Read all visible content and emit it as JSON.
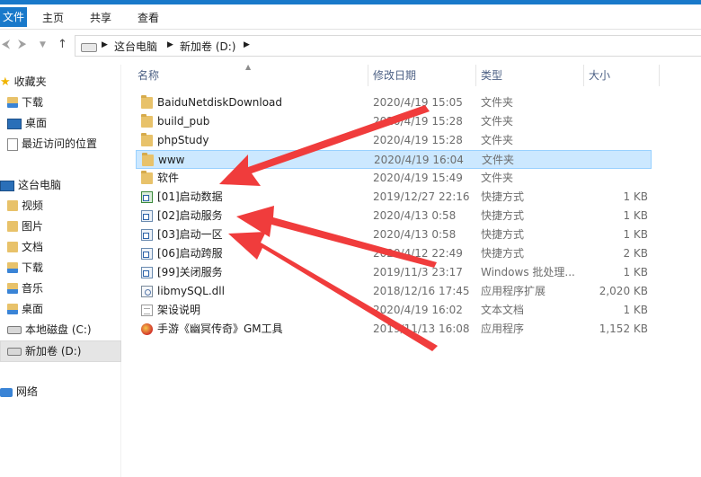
{
  "ribbon": {
    "tabs": [
      {
        "label": "文件"
      },
      {
        "label": "主页"
      },
      {
        "label": "共享"
      },
      {
        "label": "查看"
      }
    ]
  },
  "address": {
    "crumbs": [
      "这台电脑",
      "新加卷 (D:)"
    ]
  },
  "sidebar": {
    "items": [
      {
        "label": "收藏夹",
        "icon": "star-icon"
      },
      {
        "label": "下载",
        "icon": "download-folder-icon"
      },
      {
        "label": "桌面",
        "icon": "desktop-icon"
      },
      {
        "label": "最近访问的位置",
        "icon": "recent-places-icon"
      },
      {
        "label": "这台电脑",
        "icon": "computer-icon"
      },
      {
        "label": "视频",
        "icon": "videos-folder-icon"
      },
      {
        "label": "图片",
        "icon": "pictures-folder-icon"
      },
      {
        "label": "文档",
        "icon": "documents-folder-icon"
      },
      {
        "label": "下载",
        "icon": "download-folder-icon"
      },
      {
        "label": "音乐",
        "icon": "music-folder-icon"
      },
      {
        "label": "桌面",
        "icon": "desktop-folder-icon"
      },
      {
        "label": "本地磁盘 (C:)",
        "icon": "drive-icon"
      },
      {
        "label": "新加卷 (D:)",
        "icon": "drive-icon",
        "selected": true
      },
      {
        "label": "网络",
        "icon": "network-icon"
      }
    ]
  },
  "columns": {
    "name": "名称",
    "date": "修改日期",
    "type": "类型",
    "size": "大小"
  },
  "files": [
    {
      "name": "BaiduNetdiskDownload",
      "date": "2020/4/19 15:05",
      "type": "文件夹",
      "size": "",
      "icon": "folder-icon"
    },
    {
      "name": "build_pub",
      "date": "2020/4/19 15:28",
      "type": "文件夹",
      "size": "",
      "icon": "folder-icon"
    },
    {
      "name": "phpStudy",
      "date": "2020/4/19 15:28",
      "type": "文件夹",
      "size": "",
      "icon": "folder-icon"
    },
    {
      "name": "www",
      "date": "2020/4/19 16:04",
      "type": "文件夹",
      "size": "",
      "icon": "folder-icon",
      "selected": true
    },
    {
      "name": "软件",
      "date": "2020/4/19 15:49",
      "type": "文件夹",
      "size": "",
      "icon": "folder-icon"
    },
    {
      "name": "[01]启动数据",
      "date": "2019/12/27 22:16",
      "type": "快捷方式",
      "size": "1 KB",
      "icon": "shortcut-icon"
    },
    {
      "name": "[02]启动服务",
      "date": "2020/4/13 0:58",
      "type": "快捷方式",
      "size": "1 KB",
      "icon": "shortcut-icon"
    },
    {
      "name": "[03]启动一区",
      "date": "2020/4/13 0:58",
      "type": "快捷方式",
      "size": "1 KB",
      "icon": "shortcut-icon"
    },
    {
      "name": "[06]启动跨服",
      "date": "2020/4/12 22:49",
      "type": "快捷方式",
      "size": "2 KB",
      "icon": "shortcut-icon"
    },
    {
      "name": "[99]关闭服务",
      "date": "2019/11/3 23:17",
      "type": "Windows 批处理...",
      "size": "1 KB",
      "icon": "batch-file-icon"
    },
    {
      "name": "libmySQL.dll",
      "date": "2018/12/16 17:45",
      "type": "应用程序扩展",
      "size": "2,020 KB",
      "icon": "dll-file-icon"
    },
    {
      "name": "架设说明",
      "date": "2020/4/19 16:02",
      "type": "文本文档",
      "size": "1 KB",
      "icon": "text-file-icon"
    },
    {
      "name": "手游《幽冥传奇》GM工具",
      "date": "2019/11/13 16:08",
      "type": "应用程序",
      "size": "1,152 KB",
      "icon": "application-icon"
    }
  ],
  "colors": {
    "accent": "#1979ca",
    "selection": "#cce8ff",
    "annotation_arrow": "#f03c3c"
  }
}
